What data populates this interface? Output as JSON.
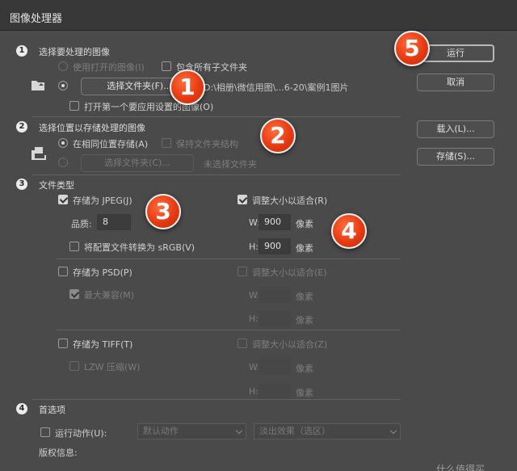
{
  "window": {
    "title": "图像处理器"
  },
  "sections": {
    "s1": {
      "num": "1",
      "title": "选择要处理的图像",
      "use_open": "使用打开的图像(I)",
      "include_sub": "包含所有子文件夹",
      "select_folder": "选择文件夹(F)...",
      "path": "D:\\相册\\微信用图\\...6-20\\案例1图片",
      "open_first": "打开第一个要应用设置的图像(O)"
    },
    "s2": {
      "num": "2",
      "title": "选择位置以存储处理的图像",
      "same_location": "在相同位置存储(A)",
      "keep_structure": "保持文件夹结构",
      "select_folder": "选择文件夹(C)...",
      "no_folder": "未选择文件夹"
    },
    "s3": {
      "num": "3",
      "title": "文件类型",
      "jpeg": "存储为 JPEG(J)",
      "quality_label": "品质:",
      "quality_value": "8",
      "srgb": "将配置文件转换为 sRGB(V)",
      "resize_jpeg": "调整大小以适合(R)",
      "w_label": "W:",
      "h_label": "H:",
      "w_value": "900",
      "h_value": "900",
      "px": "像素",
      "psd": "存储为 PSD(P)",
      "max_compat": "最大兼容(M)",
      "resize_psd": "调整大小以适合(E)",
      "tiff": "存储为 TIFF(T)",
      "lzw": "LZW 压缩(W)",
      "resize_tiff": "调整大小以适合(Z)"
    },
    "s4": {
      "num": "4",
      "title": "首选项",
      "run_action": "运行动作(U):",
      "action_default": "默认动作",
      "action_selected": "淡出效果（选区）",
      "copyright": "版权信息:"
    }
  },
  "buttons": {
    "run": "运行",
    "cancel": "取消",
    "load": "载入(L)...",
    "save": "存储(S)..."
  },
  "badges": [
    "1",
    "2",
    "3",
    "4",
    "5"
  ],
  "watermark": "什么值得买",
  "colors": {
    "badge": "#e63a12",
    "dialog_bg": "#4a4a4a"
  },
  "icons": [
    "folder-image-icon",
    "folder-save-icon"
  ]
}
